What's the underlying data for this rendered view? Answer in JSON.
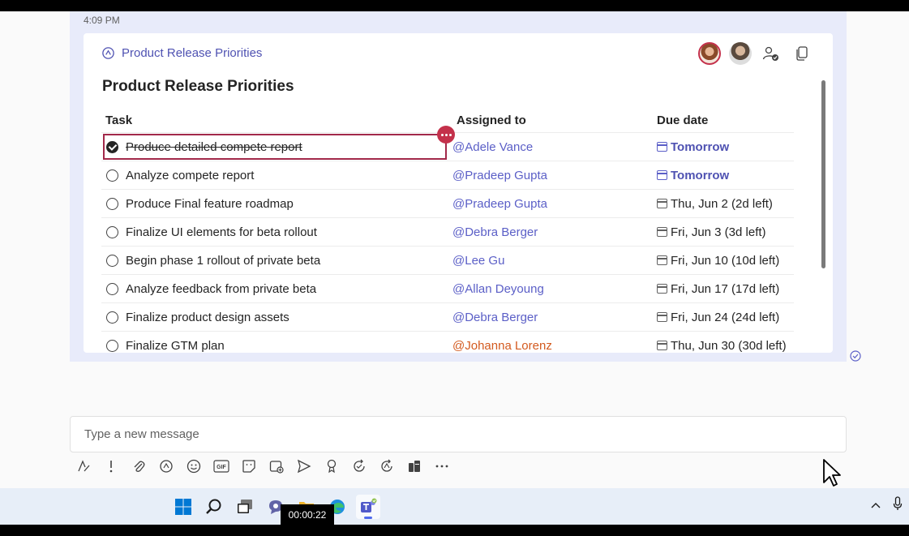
{
  "chat": {
    "timestamp": "4:09 PM",
    "card": {
      "header_title": "Product Release Priorities",
      "title": "Product Release Priorities",
      "columns": {
        "task": "Task",
        "assigned": "Assigned to",
        "due": "Due date"
      },
      "rows": [
        {
          "task": "Produce detailed compete report",
          "done": true,
          "assignee": "@Adele Vance",
          "due": "Tomorrow"
        },
        {
          "task": "Analyze compete report",
          "done": false,
          "assignee": "@Pradeep Gupta",
          "due": "Tomorrow"
        },
        {
          "task": "Produce Final feature roadmap",
          "done": false,
          "assignee": "@Pradeep Gupta",
          "due": "Thu, Jun 2 (2d left)"
        },
        {
          "task": "Finalize UI elements for beta rollout",
          "done": false,
          "assignee": "@Debra Berger",
          "due": "Fri, Jun 3 (3d left)"
        },
        {
          "task": "Begin phase 1 rollout of private beta",
          "done": false,
          "assignee": "@Lee Gu",
          "due": "Fri, Jun 10 (10d left)"
        },
        {
          "task": "Analyze feedback from private beta",
          "done": false,
          "assignee": "@Allan Deyoung",
          "due": "Fri, Jun 17 (17d left)"
        },
        {
          "task": "Finalize product design assets",
          "done": false,
          "assignee": "@Debra Berger",
          "due": "Fri, Jun 24 (24d left)"
        },
        {
          "task": "Finalize GTM plan",
          "done": false,
          "assignee": "@Johanna Lorenz",
          "due": "Thu, Jun 30 (30d left)"
        }
      ]
    }
  },
  "composer": {
    "placeholder": "Type a new message"
  },
  "toolbar_icons": [
    "format-icon",
    "important-icon",
    "attach-icon",
    "loop-icon",
    "emoji-icon",
    "gif-icon",
    "sticker-icon",
    "meet-icon",
    "send-icon",
    "praise-icon",
    "update-icon",
    "loop-update-icon",
    "apps-icon",
    "more-icon"
  ],
  "taskbar": {
    "video_time": "00:00:22"
  },
  "colors": {
    "accent": "#5b5fc7",
    "brand_dark": "#4f52b2",
    "selection": "#a2294a",
    "mention_orange": "#d35a1f"
  }
}
